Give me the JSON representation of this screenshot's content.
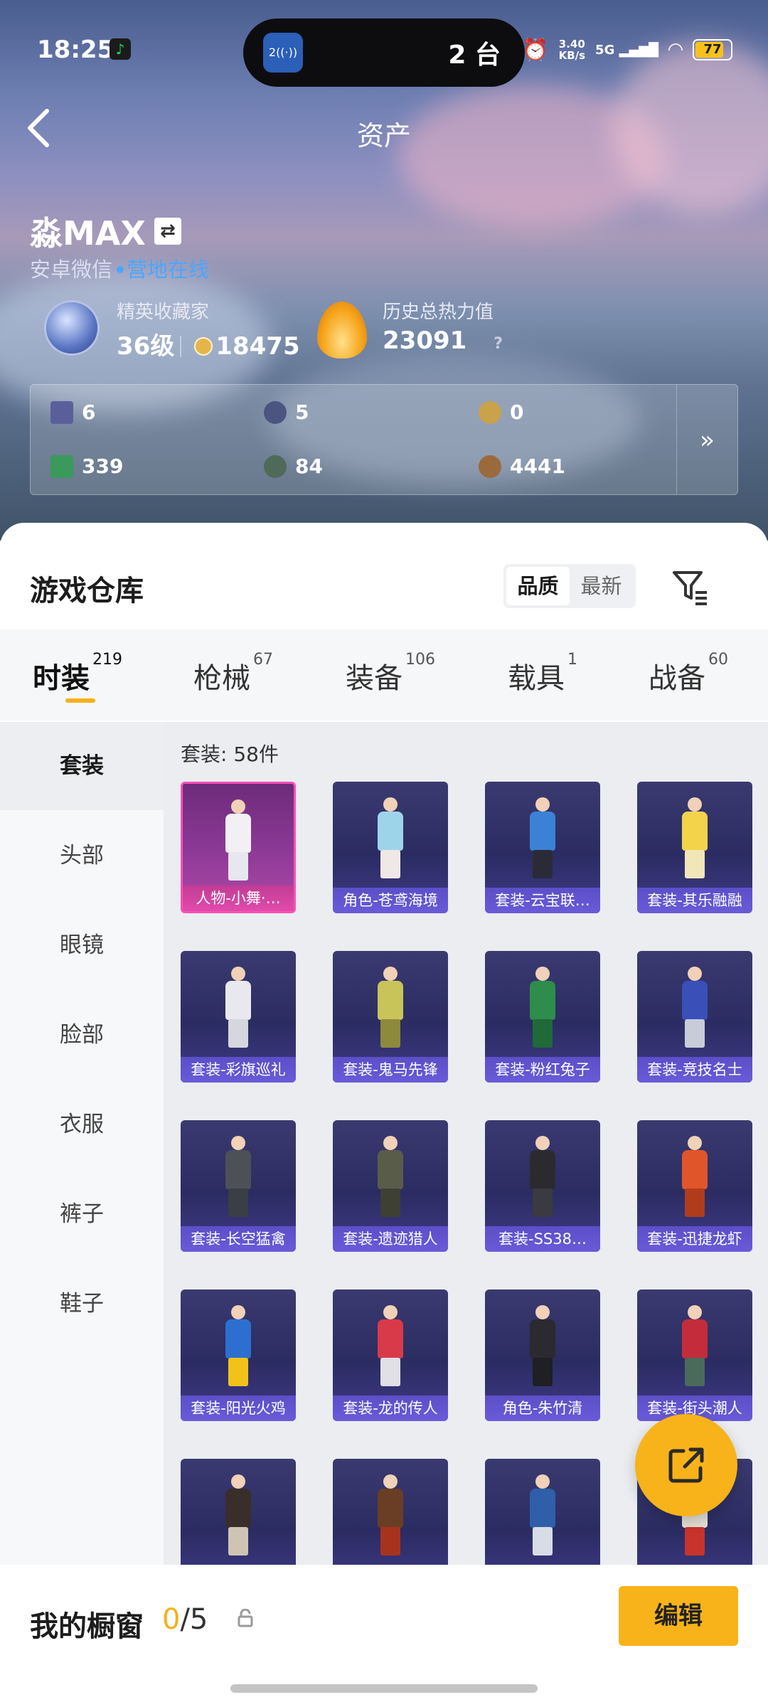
{
  "status_bar": {
    "time": "18:25",
    "pill_text": "2 台",
    "pill_icon_num": "2",
    "net_speed_1": "3.40",
    "net_speed_2": "KB/s",
    "signal": "5G",
    "battery": "77"
  },
  "nav": {
    "title": "资产",
    "back_icon": "chevron-left-icon"
  },
  "player": {
    "name": "淼MAX",
    "platform": "安卓微信",
    "online_status": "营地在线",
    "rank_label": "精英收藏家",
    "rank_level": "36级",
    "rank_points": "18475",
    "heat_label": "历史总热力值",
    "heat_value": "23091",
    "heat_help": "?"
  },
  "currencies": [
    {
      "value": "6",
      "color": "#5a5f9c"
    },
    {
      "value": "5",
      "color": "#4c5580"
    },
    {
      "value": "0",
      "color": "#c9a24a"
    },
    {
      "value": "339",
      "color": "#3a9a5c"
    },
    {
      "value": "84",
      "color": "#4f6a58"
    },
    {
      "value": "4441",
      "color": "#9a6a3c"
    }
  ],
  "more_label": "»",
  "warehouse": {
    "title": "游戏仓库",
    "sort_options": [
      "品质",
      "最新"
    ],
    "tabs": [
      {
        "label": "时装",
        "count": "219"
      },
      {
        "label": "枪械",
        "count": "67"
      },
      {
        "label": "装备",
        "count": "106"
      },
      {
        "label": "载具",
        "count": "1"
      },
      {
        "label": "战备",
        "count": "60"
      }
    ],
    "categories": [
      "套装",
      "头部",
      "眼镜",
      "脸部",
      "衣服",
      "裤子",
      "鞋子"
    ],
    "count_label": "套装: 58件",
    "items": [
      {
        "name": "人物-小舞·…",
        "body": "#f2f0f4",
        "legs": "#e8e6ef"
      },
      {
        "name": "角色-苍鸢海境",
        "body": "#9ed4ea",
        "legs": "#f0e8e6"
      },
      {
        "name": "套装-云宝联…",
        "body": "#3b82d6",
        "legs": "#2b2b38"
      },
      {
        "name": "套装-其乐融融",
        "body": "#f3d34a",
        "legs": "#f0e6b8"
      },
      {
        "name": "套装-彩旗巡礼",
        "body": "#e8e8ee",
        "legs": "#d6d6df"
      },
      {
        "name": "套装-鬼马先锋",
        "body": "#c8c45a",
        "legs": "#8d8a3c"
      },
      {
        "name": "套装-粉红兔子",
        "body": "#2e8c4c",
        "legs": "#1f6a38"
      },
      {
        "name": "套装-竞技名士",
        "body": "#3a4fb8",
        "legs": "#c8ccd8"
      },
      {
        "name": "套装-长空猛禽",
        "body": "#4e5058",
        "legs": "#3c3e46"
      },
      {
        "name": "套装-遗迹猎人",
        "body": "#5a5c4a",
        "legs": "#3e4034"
      },
      {
        "name": "套装-SS38…",
        "body": "#2b2b2f",
        "legs": "#3a3a40"
      },
      {
        "name": "套装-迅捷龙虾",
        "body": "#e0552a",
        "legs": "#b03c1c"
      },
      {
        "name": "套装-阳光火鸡",
        "body": "#2d6fd0",
        "legs": "#f2c21a"
      },
      {
        "name": "套装-龙的传人",
        "body": "#d83a4a",
        "legs": "#e0e0e6"
      },
      {
        "name": "角色-朱竹清",
        "body": "#2a2a30",
        "legs": "#1f1f24"
      },
      {
        "name": "套装-街头潮人",
        "body": "#c42c3c",
        "legs": "#4a6a5c"
      },
      {
        "name": "",
        "body": "#3a2e2a",
        "legs": "#cfc4b4"
      },
      {
        "name": "",
        "body": "#6a3e24",
        "legs": "#a8331c"
      },
      {
        "name": "",
        "body": "#2e5fa8",
        "legs": "#d8dce6"
      },
      {
        "name": "",
        "body": "#e6e0d8",
        "legs": "#c8332c"
      }
    ]
  },
  "showcase": {
    "label": "我的橱窗",
    "current": "0",
    "total": "/5",
    "edit_label": "编辑"
  }
}
